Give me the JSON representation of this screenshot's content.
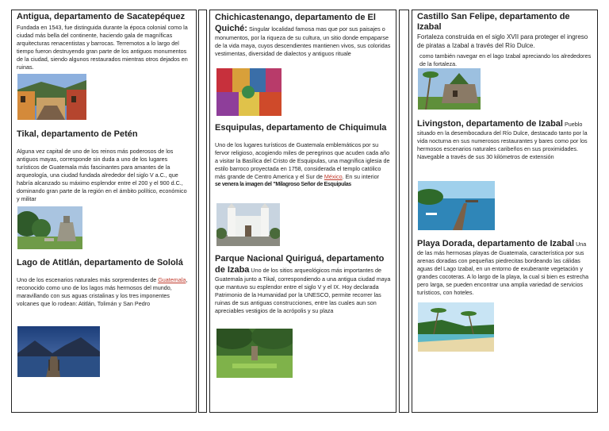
{
  "col1": {
    "s1": {
      "title": "Antigua, departamento de Sacatepéquez",
      "body": "Fundada en 1543, fue distinguida durante la época colonial como la ciudad más bella del continente, haciendo gala de magníficas arquitecturas renacentistas y barrocas. Terremotos a lo largo del tiempo fueron destruyendo gran parte de los antiguos monumentos de la ciudad, siendo algunos restaurados mientras otros dejados en ruinas."
    },
    "s2": {
      "title": "Tikal, departamento de Petén",
      "body": "Alguna vez capital de uno de los reinos más poderosos de los antiguos mayas, corresponde sin duda a uno de los lugares turísticos de Guatemala más fascinantes para amantes de la arqueología, una ciudad fundada alrededor del siglo V a.C., que habría alcanzado su máximo esplendor entre el 200 y el 900 d.C., dominando gran parte de la región en el ámbito político, económico y militar"
    },
    "s3": {
      "title": "Lago de Atitlán, departamento de Sololá",
      "body_a": "Uno de los escenarios naturales más sorprendentes de ",
      "link": "Guatemala",
      "body_b": ", reconocido como uno de los lagos más hermosos del mundo, maravillando con sus aguas cristalinas y los tres imponentes volcanes que lo rodean: Atitlán, Tolimán y San Pedro"
    }
  },
  "col2": {
    "s1": {
      "title": "Chichicastenango, departamento de El Quiché:",
      "body": "Singular localidad famosa mas que por sus paisajes o monumentos, por la riqueza de su cultura, un sitio donde empaparse de la vida maya, cuyos descendientes mantienen vivos, sus coloridas vestimentas, diversidad de dialectos y antiguos rituale"
    },
    "s2": {
      "title": "Esquipulas, departamento de Chiquimula",
      "body_a": "Uno de los lugares turísticos de Guatemala emblemáticos por su fervor religioso, acogiendo miles de peregrinos que acuden cada año a visitar la Basílica del Cristo de Esquipulas, una magnífica iglesia de estilo barroco proyectada en 1758, considerada el templo católico más grande de Centro America y el Sur de ",
      "link": "México",
      "body_b": ". En su interior",
      "body_c": "se venera la imagen del \"Milagroso Señor de Esquipulas"
    },
    "s3": {
      "title": "Parque Nacional Quiriguá, departamento de Izaba",
      "body": "Uno de los sitios arqueológicos más importantes de Guatemala junto a Tikal, correspondiendo a una antigua ciudad maya que mantuvo su esplendor entre el siglo V y el IX. Hoy declarada Patrimonio de la Humanidad por la UNESCO, permite recorrer las ruinas de sus antiguas construcciones, entre las cuales aun son apreciables vestigios de la acrópolis y su plaza"
    }
  },
  "col3": {
    "s1": {
      "title": "Castillo San Felipe, departamento de Izabal",
      "body": "Fortaleza construida en el siglo XVII para proteger el ingreso de piratas a Izabal a través del Río Dulce.",
      "body2": "como también navegar en el lago Izabal apreciando los alrededores de la fortaleza."
    },
    "s2": {
      "title": "Livingston, departamento de Izabal",
      "body": "Pueblo situado en la desembocadura del Río Dulce, destacado tanto por la vida nocturna en sus numerosos restaurantes y bares como por los hermosos escenarios naturales caribeños en sus proximidades. Navegable a través de sus 30 kilómetros de extensión"
    },
    "s3": {
      "title": "Playa Dorada, departamento de Izabal",
      "body": "Una de las más hermosas playas de Guatemala, característica por sus arenas doradas con pequeñas piedrecitas bordeando las cálidas aguas del Lago Izabal, en un entorno de exuberante vegetación y grandes cocoteras. A lo largo de la playa, la cual si bien es estrecha pero larga, se pueden encontrar una amplia variedad de servicios turísticos, con hoteles."
    }
  }
}
